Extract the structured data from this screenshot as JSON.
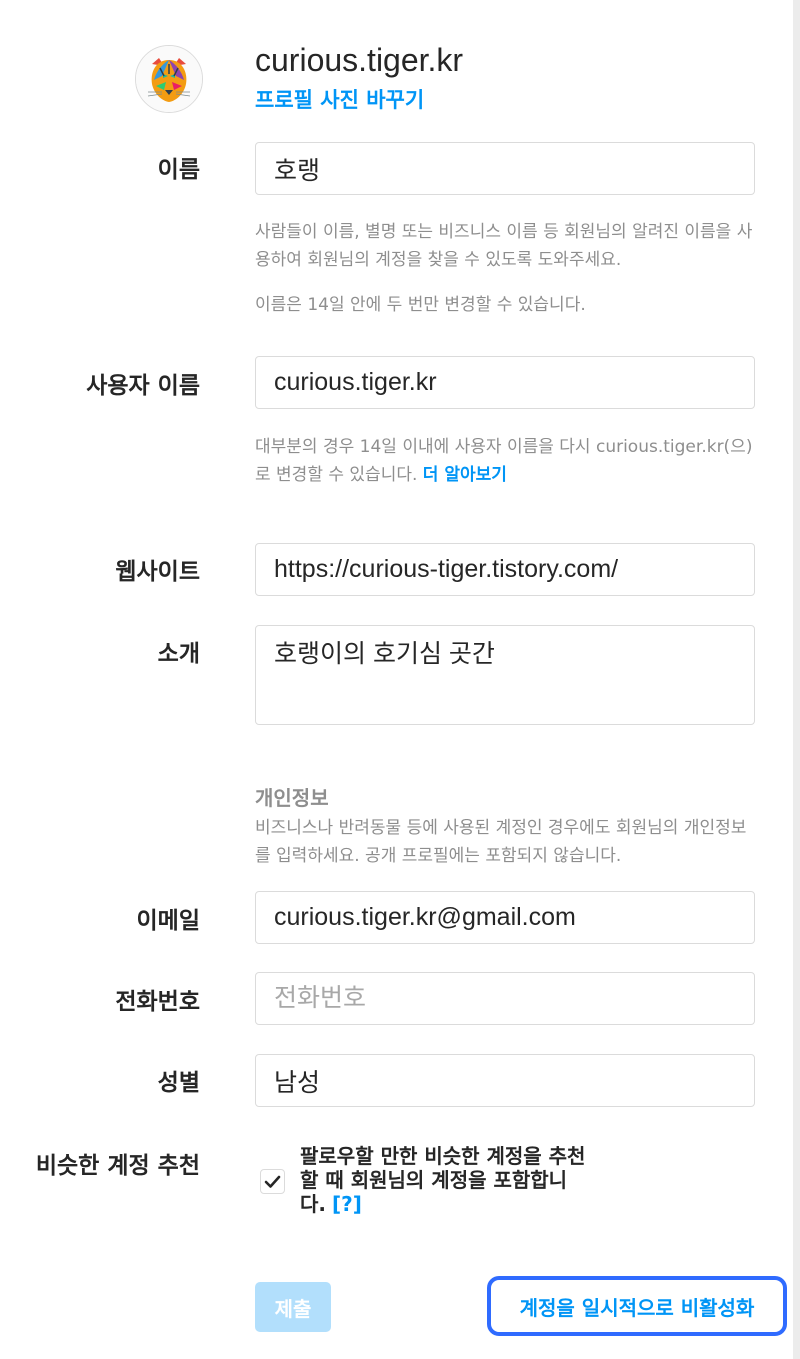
{
  "profile": {
    "username": "curious.tiger.kr",
    "change_photo": "프로필 사진 바꾸기"
  },
  "form": {
    "name": {
      "label": "이름",
      "value": "호랭",
      "help1": "사람들이 이름, 별명 또는 비즈니스 이름 등 회원님의 알려진 이름을 사용하여 회원님의 계정을 찾을 수 있도록 도와주세요.",
      "help2": "이름은 14일 안에 두 번만 변경할 수 있습니다."
    },
    "username": {
      "label": "사용자 이름",
      "value": "curious.tiger.kr",
      "help": "대부분의 경우 14일 이내에 사용자 이름을 다시 curious.tiger.kr(으)로 변경할 수 있습니다.",
      "learn_more": "더 알아보기"
    },
    "website": {
      "label": "웹사이트",
      "value": "https://curious-tiger.tistory.com/"
    },
    "bio": {
      "label": "소개",
      "value": "호랭이의 호기심 곳간"
    },
    "private_info": {
      "title": "개인정보",
      "description": "비즈니스나 반려동물 등에 사용된 계정인 경우에도 회원님의 개인정보를 입력하세요. 공개 프로필에는 포함되지 않습니다."
    },
    "email": {
      "label": "이메일",
      "value": "curious.tiger.kr@gmail.com"
    },
    "phone": {
      "label": "전화번호",
      "placeholder": "전화번호"
    },
    "gender": {
      "label": "성별",
      "value": "남성"
    },
    "suggestions": {
      "label": "비슷한 계정 추천",
      "text": "팔로우할 만한 비슷한 계정을 추천할 때 회원님의 계정을 포함합니다.",
      "help_link": "[?]",
      "checked": true
    }
  },
  "actions": {
    "submit": "제출",
    "deactivate": "계정을 일시적으로 비활성화"
  },
  "colors": {
    "accent": "#0095f6",
    "submit_disabled": "#b2dffc",
    "highlight_border": "#2f6bff"
  }
}
